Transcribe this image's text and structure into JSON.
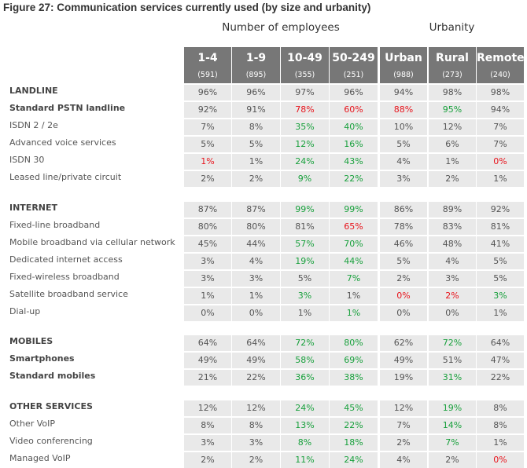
{
  "title": "Figure 27: Communication services currently used (by size and urbanity)",
  "groups": {
    "employees": "Number of employees",
    "urbanity": "Urbanity"
  },
  "columns": [
    {
      "label": "1-4",
      "n": "(591)"
    },
    {
      "label": "1-9",
      "n": "(895)"
    },
    {
      "label": "10-49",
      "n": "(355)"
    },
    {
      "label": "50-249",
      "n": "(251)"
    },
    {
      "label": "Urban",
      "n": "(988)"
    },
    {
      "label": "Rural",
      "n": "(273)"
    },
    {
      "label": "Remote",
      "n": "(240)"
    }
  ],
  "colors": {
    "red": "#e8141c",
    "green": "#18a03c",
    "header_bg": "#777777",
    "cell_bg": "#e9e9e9"
  },
  "sections": [
    {
      "rows": [
        {
          "label": "LANDLINE",
          "bold": true,
          "values": [
            "96%",
            "96%",
            "97%",
            "96%",
            "94%",
            "98%",
            "98%"
          ],
          "hl": [
            "",
            "",
            "",
            "",
            "",
            "",
            ""
          ]
        },
        {
          "label": "Standard PSTN landline",
          "bold": true,
          "values": [
            "92%",
            "91%",
            "78%",
            "60%",
            "88%",
            "95%",
            "94%"
          ],
          "hl": [
            "",
            "",
            "r",
            "r",
            "r",
            "g",
            ""
          ]
        },
        {
          "label": "ISDN 2 / 2e",
          "values": [
            "7%",
            "8%",
            "35%",
            "40%",
            "10%",
            "12%",
            "7%"
          ],
          "hl": [
            "",
            "",
            "g",
            "g",
            "",
            "",
            ""
          ]
        },
        {
          "label": "Advanced voice services",
          "values": [
            "5%",
            "5%",
            "12%",
            "16%",
            "5%",
            "6%",
            "7%"
          ],
          "hl": [
            "",
            "",
            "g",
            "g",
            "",
            "",
            ""
          ]
        },
        {
          "label": "ISDN 30",
          "values": [
            "1%",
            "1%",
            "24%",
            "43%",
            "4%",
            "1%",
            "0%"
          ],
          "hl": [
            "r",
            "",
            "g",
            "g",
            "",
            "",
            "r"
          ]
        },
        {
          "label": "Leased line/private circuit",
          "values": [
            "2%",
            "2%",
            "9%",
            "22%",
            "3%",
            "2%",
            "1%"
          ],
          "hl": [
            "",
            "",
            "g",
            "g",
            "",
            "",
            ""
          ]
        }
      ]
    },
    {
      "rows": [
        {
          "label": "INTERNET",
          "bold": true,
          "values": [
            "87%",
            "87%",
            "99%",
            "99%",
            "86%",
            "89%",
            "92%"
          ],
          "hl": [
            "",
            "",
            "g",
            "g",
            "",
            "",
            ""
          ]
        },
        {
          "label": "Fixed-line broadband",
          "values": [
            "80%",
            "80%",
            "81%",
            "65%",
            "78%",
            "83%",
            "81%"
          ],
          "hl": [
            "",
            "",
            "",
            "r",
            "",
            "",
            ""
          ]
        },
        {
          "label": "Mobile broadband via cellular network",
          "values": [
            "45%",
            "44%",
            "57%",
            "70%",
            "46%",
            "48%",
            "41%"
          ],
          "hl": [
            "",
            "",
            "g",
            "g",
            "",
            "",
            ""
          ]
        },
        {
          "label": "Dedicated internet access",
          "values": [
            "3%",
            "4%",
            "19%",
            "44%",
            "5%",
            "4%",
            "5%"
          ],
          "hl": [
            "",
            "",
            "g",
            "g",
            "",
            "",
            ""
          ]
        },
        {
          "label": "Fixed-wireless broadband",
          "values": [
            "3%",
            "3%",
            "5%",
            "7%",
            "2%",
            "3%",
            "5%"
          ],
          "hl": [
            "",
            "",
            "",
            "g",
            "",
            "",
            ""
          ]
        },
        {
          "label": "Satellite broadband service",
          "values": [
            "1%",
            "1%",
            "3%",
            "1%",
            "0%",
            "2%",
            "3%"
          ],
          "hl": [
            "",
            "",
            "g",
            "",
            "r",
            "r",
            "g"
          ]
        },
        {
          "label": "Dial-up",
          "values": [
            "0%",
            "0%",
            "1%",
            "1%",
            "0%",
            "0%",
            "1%"
          ],
          "hl": [
            "",
            "",
            "",
            "g",
            "",
            "",
            ""
          ]
        }
      ]
    },
    {
      "rows": [
        {
          "label": "MOBILES",
          "bold": true,
          "values": [
            "64%",
            "64%",
            "72%",
            "80%",
            "62%",
            "72%",
            "64%"
          ],
          "hl": [
            "",
            "",
            "g",
            "g",
            "",
            "g",
            ""
          ]
        },
        {
          "label": "Smartphones",
          "bold": true,
          "values": [
            "49%",
            "49%",
            "58%",
            "69%",
            "49%",
            "51%",
            "47%"
          ],
          "hl": [
            "",
            "",
            "g",
            "g",
            "",
            "",
            ""
          ]
        },
        {
          "label": "Standard mobiles",
          "bold": true,
          "values": [
            "21%",
            "22%",
            "36%",
            "38%",
            "19%",
            "31%",
            "22%"
          ],
          "hl": [
            "",
            "",
            "g",
            "g",
            "",
            "g",
            ""
          ]
        }
      ]
    },
    {
      "rows": [
        {
          "label": "OTHER SERVICES",
          "bold": true,
          "values": [
            "12%",
            "12%",
            "24%",
            "45%",
            "12%",
            "19%",
            "8%"
          ],
          "hl": [
            "",
            "",
            "g",
            "g",
            "",
            "g",
            ""
          ]
        },
        {
          "label": "Other VoIP",
          "values": [
            "8%",
            "8%",
            "13%",
            "22%",
            "7%",
            "14%",
            "8%"
          ],
          "hl": [
            "",
            "",
            "g",
            "g",
            "",
            "g",
            ""
          ]
        },
        {
          "label": "Video conferencing",
          "values": [
            "3%",
            "3%",
            "8%",
            "18%",
            "2%",
            "7%",
            "1%"
          ],
          "hl": [
            "",
            "",
            "g",
            "g",
            "",
            "g",
            ""
          ]
        },
        {
          "label": "Managed VoIP",
          "values": [
            "2%",
            "2%",
            "11%",
            "24%",
            "4%",
            "2%",
            "0%"
          ],
          "hl": [
            "",
            "",
            "g",
            "g",
            "",
            "",
            "r"
          ]
        }
      ]
    }
  ]
}
